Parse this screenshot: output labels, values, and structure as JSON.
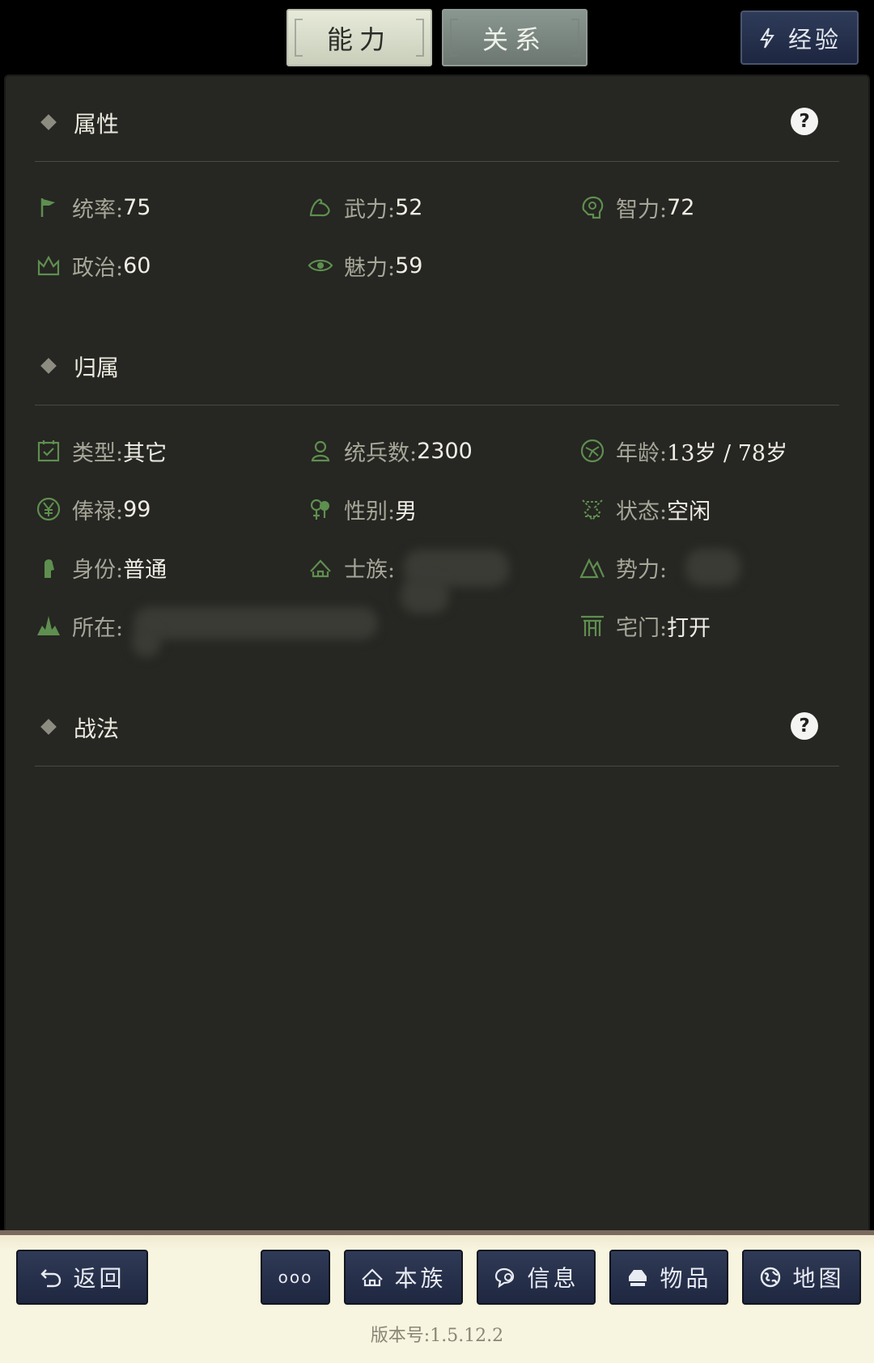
{
  "tabs": {
    "ability": "能力",
    "relation": "关系"
  },
  "experience_button": "经验",
  "sections": {
    "attributes": {
      "title": "属性",
      "stats": [
        {
          "label": "统率:",
          "value": "75",
          "icon": "flag-icon"
        },
        {
          "label": "武力:",
          "value": "52",
          "icon": "arm-icon"
        },
        {
          "label": "智力:",
          "value": "72",
          "icon": "brain-icon"
        },
        {
          "label": "政治:",
          "value": "60",
          "icon": "crown-icon"
        },
        {
          "label": "魅力:",
          "value": "59",
          "icon": "eye-icon"
        }
      ]
    },
    "affiliation": {
      "title": "归属",
      "items": [
        {
          "label": "类型:",
          "value": "其它",
          "icon": "calendar-icon"
        },
        {
          "label": "统兵数:",
          "value": "2300",
          "icon": "soldier-icon"
        },
        {
          "label": "年龄:",
          "value": "13岁 / 78岁",
          "icon": "age-icon"
        },
        {
          "label": "俸禄:",
          "value": "99",
          "icon": "yen-icon"
        },
        {
          "label": "性别:",
          "value": "男",
          "icon": "gender-icon"
        },
        {
          "label": "状态:",
          "value": "空闲",
          "icon": "status-icon"
        },
        {
          "label": "身份:",
          "value": "普通",
          "icon": "statue-icon"
        },
        {
          "label": "士族:",
          "value": "",
          "icon": "clan-icon"
        },
        {
          "label": "势力:",
          "value": "",
          "icon": "mountain-icon"
        },
        {
          "label": "所在:",
          "value": "",
          "icon": "castle-icon"
        },
        {
          "label": "宅门:",
          "value": "打开",
          "icon": "gate-icon"
        }
      ]
    },
    "tactics": {
      "title": "战法"
    }
  },
  "bottom_nav": {
    "back": "返回",
    "more": "ooo",
    "clan": "本族",
    "info": "信息",
    "items": "物品",
    "map": "地图"
  },
  "version": "版本号:1.5.12.2",
  "colors": {
    "icon_green": "#5e8f4f",
    "panel_bg": "#262622",
    "button_navy": "#26304b",
    "bottom_bg": "#f7f4df"
  }
}
